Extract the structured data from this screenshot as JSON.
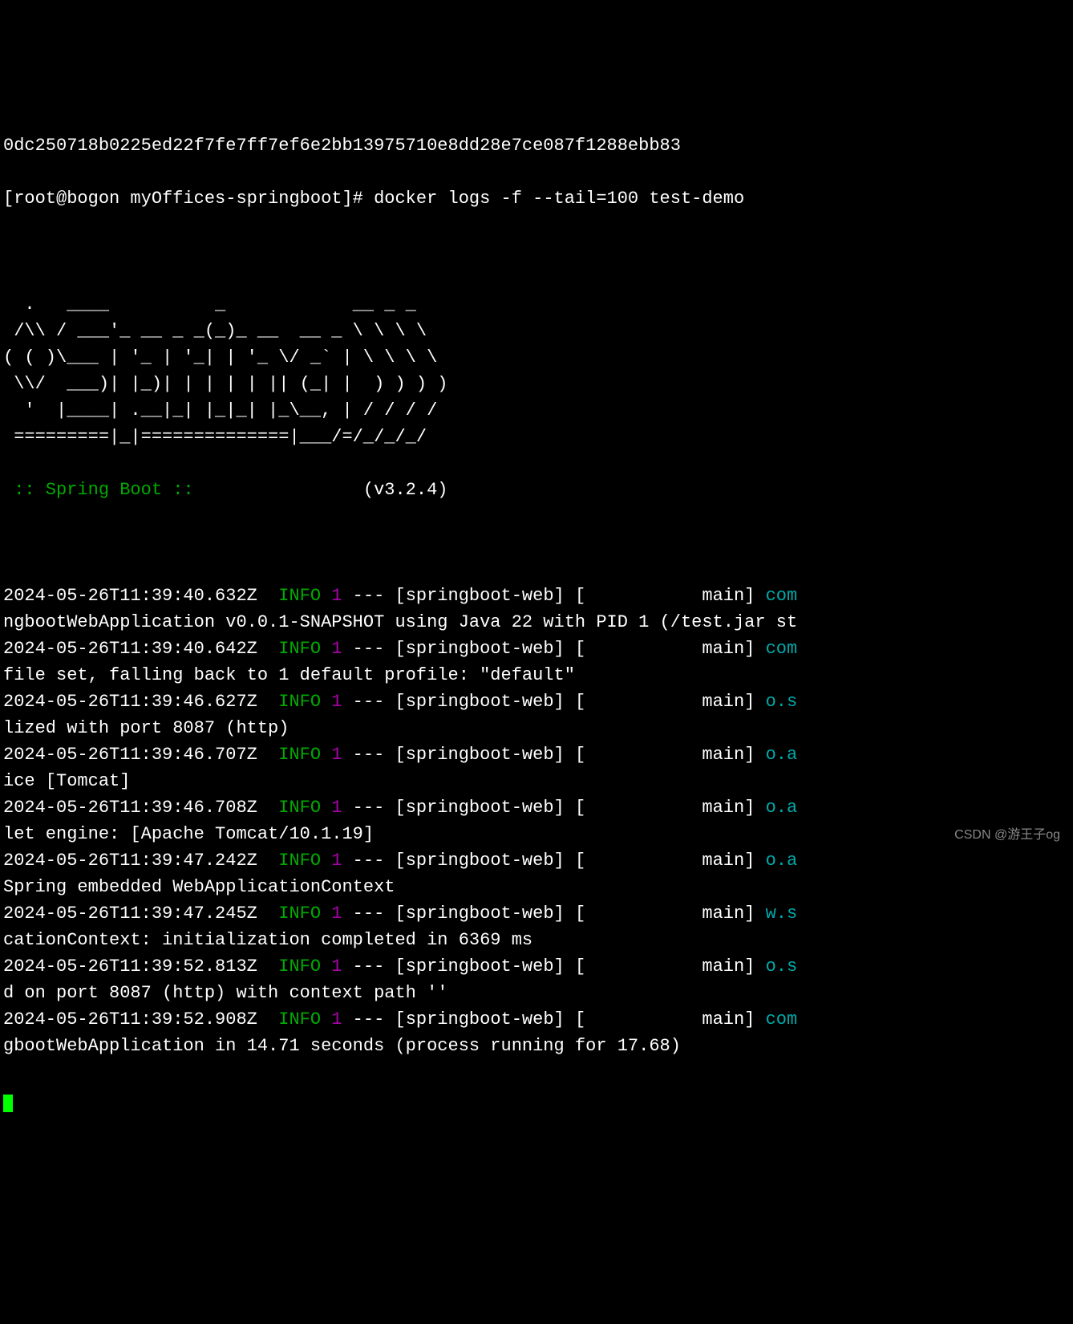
{
  "terminal": {
    "hash_line": "0dc250718b0225ed22f7fe7ff7ef6e2bb13975710e8dd28e7ce087f1288ebb83",
    "prompt": "[root@bogon myOffices-springboot]# ",
    "command": "docker logs -f --tail=100 test-demo",
    "ascii_art": "  .   ____          _            __ _ _\n /\\\\ / ___'_ __ _ _(_)_ __  __ _ \\ \\ \\ \\\n( ( )\\___ | '_ | '_| | '_ \\/ _` | \\ \\ \\ \\\n \\\\/  ___)| |_)| | | | | || (_| |  ) ) ) )\n  '  |____| .__|_| |_|_| |_\\__, | / / / /\n =========|_|==============|___/=/_/_/_/",
    "spring_label": " :: Spring Boot :: ",
    "spring_version": "               (v3.2.4)",
    "log_entries": [
      {
        "timestamp": "2024-05-26T11:39:40.632Z",
        "level": "INFO",
        "pid": "1",
        "context": "[springboot-web]",
        "thread": "[           main]",
        "logger": "com",
        "continuation": "ngbootWebApplication v0.0.1-SNAPSHOT using Java 22 with PID 1 (/test.jar st"
      },
      {
        "timestamp": "2024-05-26T11:39:40.642Z",
        "level": "INFO",
        "pid": "1",
        "context": "[springboot-web]",
        "thread": "[           main]",
        "logger": "com",
        "continuation": "file set, falling back to 1 default profile: \"default\""
      },
      {
        "timestamp": "2024-05-26T11:39:46.627Z",
        "level": "INFO",
        "pid": "1",
        "context": "[springboot-web]",
        "thread": "[           main]",
        "logger": "o.s",
        "continuation": "lized with port 8087 (http)"
      },
      {
        "timestamp": "2024-05-26T11:39:46.707Z",
        "level": "INFO",
        "pid": "1",
        "context": "[springboot-web]",
        "thread": "[           main]",
        "logger": "o.a",
        "continuation": "ice [Tomcat]"
      },
      {
        "timestamp": "2024-05-26T11:39:46.708Z",
        "level": "INFO",
        "pid": "1",
        "context": "[springboot-web]",
        "thread": "[           main]",
        "logger": "o.a",
        "continuation": "let engine: [Apache Tomcat/10.1.19]"
      },
      {
        "timestamp": "2024-05-26T11:39:47.242Z",
        "level": "INFO",
        "pid": "1",
        "context": "[springboot-web]",
        "thread": "[           main]",
        "logger": "o.a",
        "continuation": "Spring embedded WebApplicationContext"
      },
      {
        "timestamp": "2024-05-26T11:39:47.245Z",
        "level": "INFO",
        "pid": "1",
        "context": "[springboot-web]",
        "thread": "[           main]",
        "logger": "w.s",
        "continuation": "cationContext: initialization completed in 6369 ms"
      },
      {
        "timestamp": "2024-05-26T11:39:52.813Z",
        "level": "INFO",
        "pid": "1",
        "context": "[springboot-web]",
        "thread": "[           main]",
        "logger": "o.s",
        "continuation": "d on port 8087 (http) with context path ''"
      },
      {
        "timestamp": "2024-05-26T11:39:52.908Z",
        "level": "INFO",
        "pid": "1",
        "context": "[springboot-web]",
        "thread": "[           main]",
        "logger": "com",
        "continuation": "gbootWebApplication in 14.71 seconds (process running for 17.68)"
      }
    ],
    "watermark": "CSDN @游王子og"
  }
}
